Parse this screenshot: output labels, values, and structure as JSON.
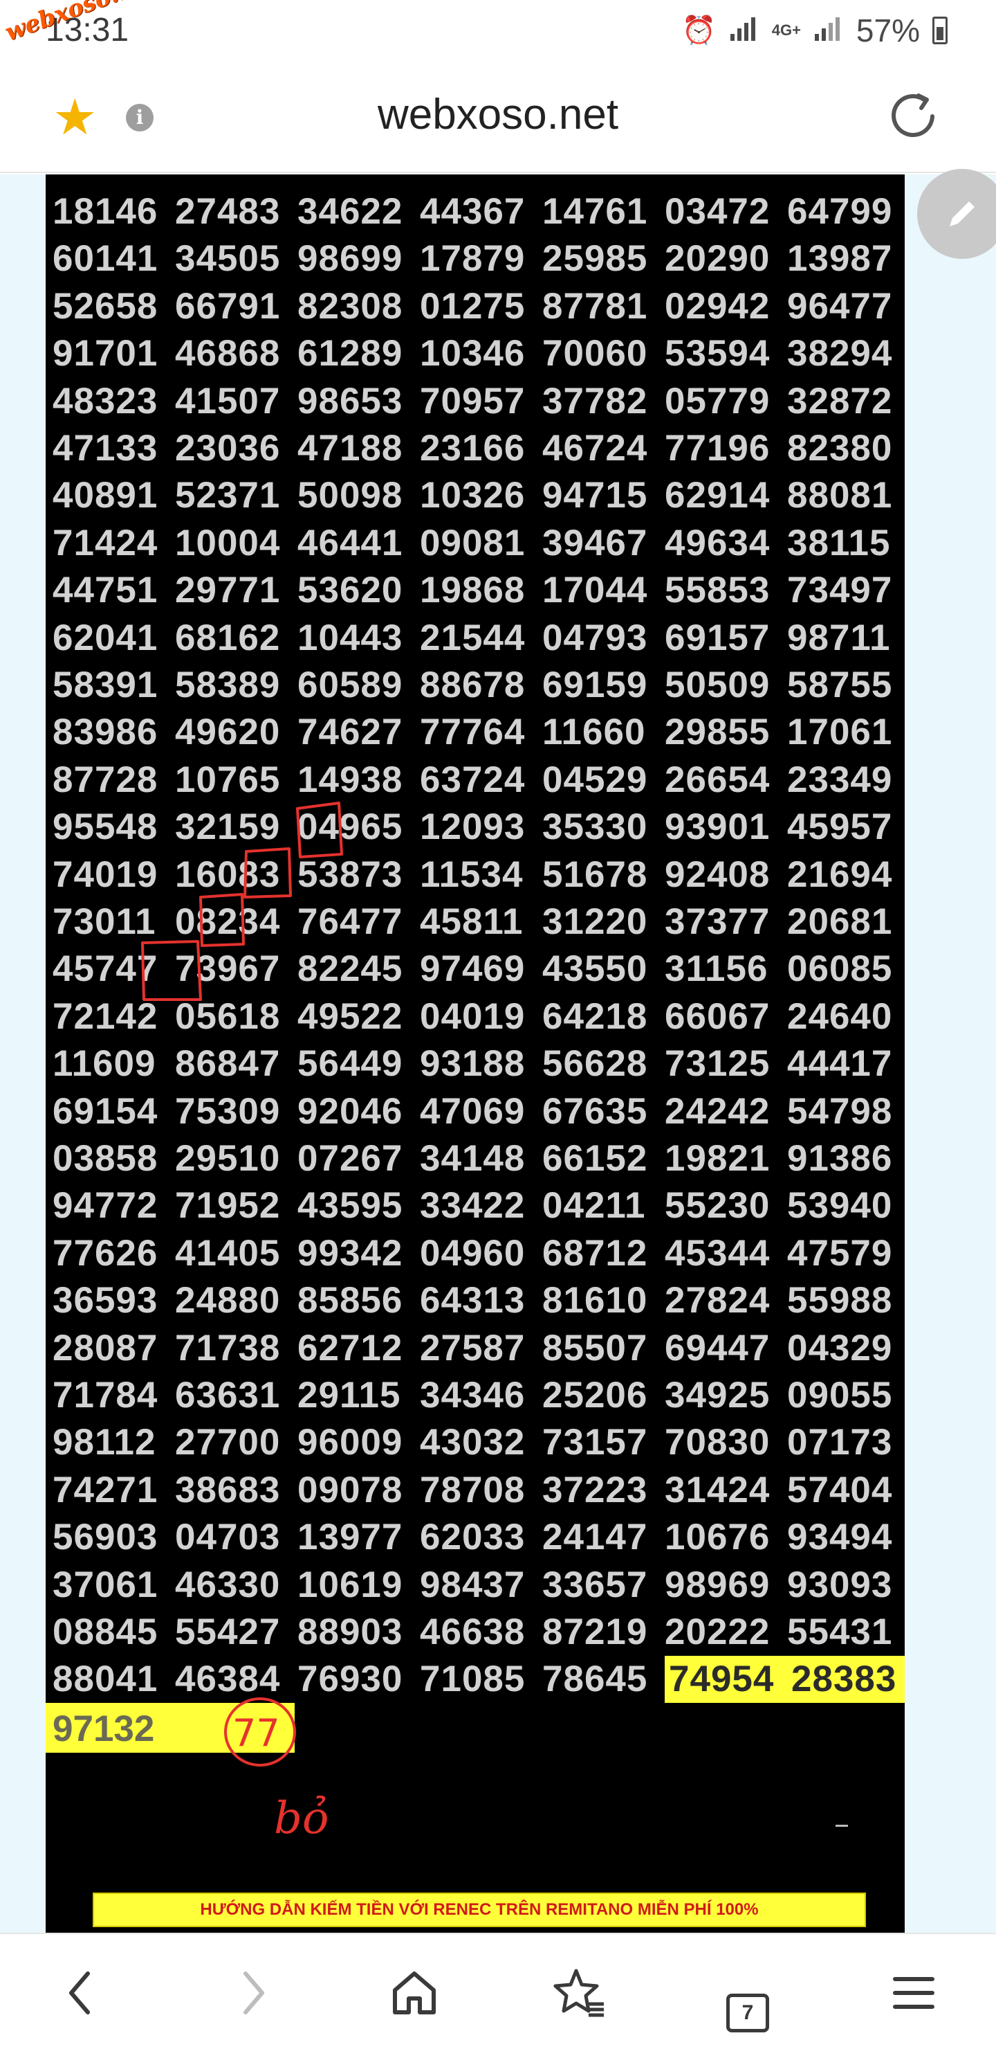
{
  "status_bar": {
    "time": "13:31",
    "network": "4G+",
    "battery": "57%",
    "watermark": "webxoso.net"
  },
  "browser": {
    "url": "webxoso.net",
    "tab_count": "7"
  },
  "results": {
    "rows": [
      [
        "18146",
        "27483",
        "34622",
        "44367",
        "14761",
        "03472",
        "64799"
      ],
      [
        "60141",
        "34505",
        "98699",
        "17879",
        "25985",
        "20290",
        "13987"
      ],
      [
        "52658",
        "66791",
        "82308",
        "01275",
        "87781",
        "02942",
        "96477"
      ],
      [
        "91701",
        "46868",
        "61289",
        "10346",
        "70060",
        "53594",
        "38294"
      ],
      [
        "48323",
        "41507",
        "98653",
        "70957",
        "37782",
        "05779",
        "32872"
      ],
      [
        "47133",
        "23036",
        "47188",
        "23166",
        "46724",
        "77196",
        "82380"
      ],
      [
        "40891",
        "52371",
        "50098",
        "10326",
        "94715",
        "62914",
        "88081"
      ],
      [
        "71424",
        "10004",
        "46441",
        "09081",
        "39467",
        "49634",
        "38115"
      ],
      [
        "44751",
        "29771",
        "53620",
        "19868",
        "17044",
        "55853",
        "73497"
      ],
      [
        "62041",
        "68162",
        "10443",
        "21544",
        "04793",
        "69157",
        "98711"
      ],
      [
        "58391",
        "58389",
        "60589",
        "88678",
        "69159",
        "50509",
        "58755"
      ],
      [
        "83986",
        "49620",
        "74627",
        "77764",
        "11660",
        "29855",
        "17061"
      ],
      [
        "87728",
        "10765",
        "14938",
        "63724",
        "04529",
        "26654",
        "23349"
      ],
      [
        "95548",
        "32159",
        "04965",
        "12093",
        "35330",
        "93901",
        "45957"
      ],
      [
        "74019",
        "16083",
        "53873",
        "11534",
        "51678",
        "92408",
        "21694"
      ],
      [
        "73011",
        "08234",
        "76477",
        "45811",
        "31220",
        "37377",
        "20681"
      ],
      [
        "45747",
        "73967",
        "82245",
        "97469",
        "43550",
        "31156",
        "06085"
      ],
      [
        "72142",
        "05618",
        "49522",
        "04019",
        "64218",
        "66067",
        "24640"
      ],
      [
        "11609",
        "86847",
        "56449",
        "93188",
        "56628",
        "73125",
        "44417"
      ],
      [
        "69154",
        "75309",
        "92046",
        "47069",
        "67635",
        "24242",
        "54798"
      ],
      [
        "03858",
        "29510",
        "07267",
        "34148",
        "66152",
        "19821",
        "91386"
      ],
      [
        "94772",
        "71952",
        "43595",
        "33422",
        "04211",
        "55230",
        "53940"
      ],
      [
        "77626",
        "41405",
        "99342",
        "04960",
        "68712",
        "45344",
        "47579"
      ],
      [
        "36593",
        "24880",
        "85856",
        "64313",
        "81610",
        "27824",
        "55988"
      ],
      [
        "28087",
        "71738",
        "62712",
        "27587",
        "85507",
        "69447",
        "04329"
      ],
      [
        "71784",
        "63631",
        "29115",
        "34346",
        "25206",
        "34925",
        "09055"
      ],
      [
        "98112",
        "27700",
        "96009",
        "43032",
        "73157",
        "70830",
        "07173"
      ],
      [
        "74271",
        "38683",
        "09078",
        "78708",
        "37223",
        "31424",
        "57404"
      ],
      [
        "56903",
        "04703",
        "13977",
        "62033",
        "24147",
        "10676",
        "93494"
      ],
      [
        "37061",
        "46330",
        "10619",
        "98437",
        "33657",
        "98969",
        "93093"
      ],
      [
        "08845",
        "55427",
        "88903",
        "46638",
        "87219",
        "20222",
        "55431"
      ],
      [
        "88041",
        "46384",
        "76930",
        "71085",
        "78645",
        "74954",
        "28383"
      ]
    ],
    "final_number": "97132"
  },
  "annotations": {
    "circled": "77",
    "note": "bỏ"
  },
  "promo": {
    "text": "HƯỚNG DẪN KIẾM TIỀN VỚI RENEC TRÊN REMITANO MIỄN PHÍ 100%"
  },
  "colors": {
    "panel": "#000000",
    "numbers": "#d2d2d2",
    "highlight": "#ffff3a",
    "annotation_red": "#e5322d",
    "promo_text": "#d11a1a"
  },
  "icons": {
    "favorite": "star-icon",
    "info": "info-icon",
    "reload": "reload-icon",
    "edit": "pencil-icon",
    "back": "chevron-left-icon",
    "forward": "chevron-right-icon",
    "home": "home-icon",
    "bookmarks": "star-list-icon",
    "tabs": "tabs-icon",
    "menu": "menu-icon"
  }
}
